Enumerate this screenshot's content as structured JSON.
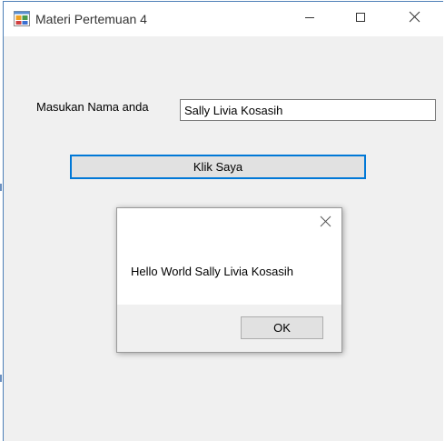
{
  "window": {
    "title": "Materi Pertemuan 4",
    "controls": [
      "minimize-icon",
      "maximize-icon",
      "close-icon"
    ]
  },
  "form": {
    "name_label": "Masukan Nama anda",
    "name_value": "Sally Livia Kosasih",
    "button_label": "Klik Saya"
  },
  "dialog": {
    "message": "Hello World Sally Livia Kosasih",
    "ok_label": "OK",
    "close_icon": "close-icon"
  },
  "colors": {
    "accent": "#0078d7",
    "window_bg": "#f0f0f0",
    "titlebar_bg": "#ffffff"
  }
}
